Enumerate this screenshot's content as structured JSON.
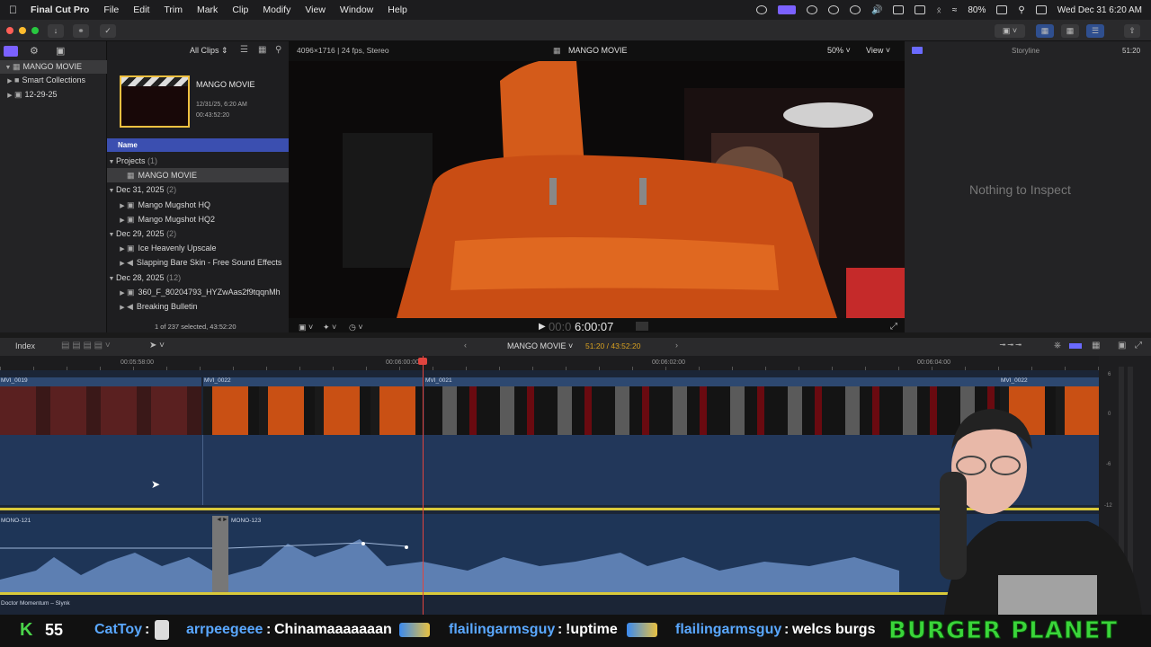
{
  "menubar": {
    "app_name": "Final Cut Pro",
    "menus": [
      "File",
      "Edit",
      "Trim",
      "Mark",
      "Clip",
      "Modify",
      "View",
      "Window",
      "Help"
    ],
    "battery": "80%",
    "clock": "Wed Dec 31  6:20 AM"
  },
  "sidebar": {
    "library": "MANGO MOVIE",
    "items": [
      {
        "label": "Smart Collections"
      },
      {
        "label": "12-29-25"
      }
    ]
  },
  "browser": {
    "filter": "All Clips",
    "project_card": {
      "title": "MANGO MOVIE",
      "date": "12/31/25, 6:20 AM",
      "duration": "00:43:52:20"
    },
    "column_header": "Name",
    "groups": [
      {
        "label": "Projects",
        "count": "(1)",
        "items": [
          "MANGO MOVIE"
        ]
      },
      {
        "label": "Dec 31, 2025",
        "count": "(2)",
        "items": [
          "Mango Mugshot HQ",
          "Mango Mugshot HQ2"
        ]
      },
      {
        "label": "Dec 29, 2025",
        "count": "(2)",
        "items": [
          "Ice Heavenly Upscale",
          "Slapping Bare Skin - Free Sound Effects"
        ]
      },
      {
        "label": "Dec 28, 2025",
        "count": "(12)",
        "items": [
          "360_F_80204793_HYZwAas2f9tqqnMh",
          "Breaking Bulletin"
        ]
      }
    ],
    "selection_status": "1 of 237 selected, 43:52:20"
  },
  "viewer": {
    "format": "4096×1716 | 24 fps, Stereo",
    "title": "MANGO MOVIE",
    "zoom": "50%",
    "view_label": "View",
    "timecode_dim": "00:0",
    "timecode": "6:00:07"
  },
  "inspector": {
    "storyline_label": "Storyline",
    "time": "51:20",
    "empty_text": "Nothing to Inspect"
  },
  "timeline": {
    "index_label": "Index",
    "project": "MANGO MOVIE",
    "position": "51:20 / 43:52:20",
    "ruler": [
      "00:05:58:00",
      "00:06:00:00",
      "00:06:02:00",
      "00:06:04:00"
    ],
    "video_clips": [
      "MVI_0019",
      "MVI_0022",
      "MVI_0021",
      "MVI_0022"
    ],
    "audio_clips": [
      "MONO-121",
      "MONO-123"
    ],
    "music_clip": "Doctor Momentum – Slynk",
    "meter_labels": [
      "6",
      "0",
      "-6",
      "-12"
    ]
  },
  "stream": {
    "k_count": "55",
    "chat": [
      {
        "user": "CatToy",
        "message": ""
      },
      {
        "user": "arrpeegeee",
        "message": "Chinamaaaaaaan"
      },
      {
        "user": "flailingarmsguy",
        "message": "!uptime"
      },
      {
        "user": "flailingarmsguy",
        "message": "welcs burgs"
      }
    ],
    "logo_text": "BURGER PLANET"
  },
  "colors": {
    "accent": "#7b61ff",
    "browser_selection": "#3b4fb0",
    "video_clip": "#2d4870",
    "audio_track": "#1e3557",
    "playhead": "#e0443e",
    "k_green": "#4ad34a",
    "chat_user": "#5aa8ff",
    "logo_green": "#3ad53a"
  }
}
